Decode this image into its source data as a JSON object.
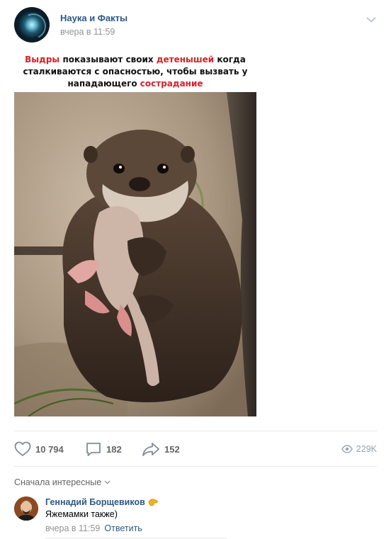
{
  "post": {
    "community_name": "Наука и Факты",
    "time": "вчера в 11:59",
    "caption": {
      "line1": {
        "red1": "Выдры",
        "text1": " показывают своих ",
        "red2": "детенышей",
        "text2": " когда"
      },
      "line2": "сталкиваются с опасностью, чтобы вызвать у",
      "line3": {
        "text": "нападающего ",
        "red": "сострадание"
      }
    },
    "image_subject": "otter-holding-pup-photo"
  },
  "actions": {
    "likes": "10 794",
    "comments": "182",
    "shares": "152",
    "views": "229K"
  },
  "comments_section": {
    "sort_label": "Сначала интересные",
    "items": [
      {
        "author": "Геннадий Борщевиков",
        "text": "Яжемамки также)",
        "time": "вчера в 11:59",
        "reply_label": "Ответить"
      }
    ]
  },
  "colors": {
    "link": "#2a5885",
    "caption_red": "#d6202c",
    "muted": "#939393",
    "icon": "#828a99"
  },
  "icons": [
    "chevron-down-icon",
    "heart-icon",
    "comment-icon",
    "share-icon",
    "eye-icon",
    "clapping-hands-emoji"
  ]
}
